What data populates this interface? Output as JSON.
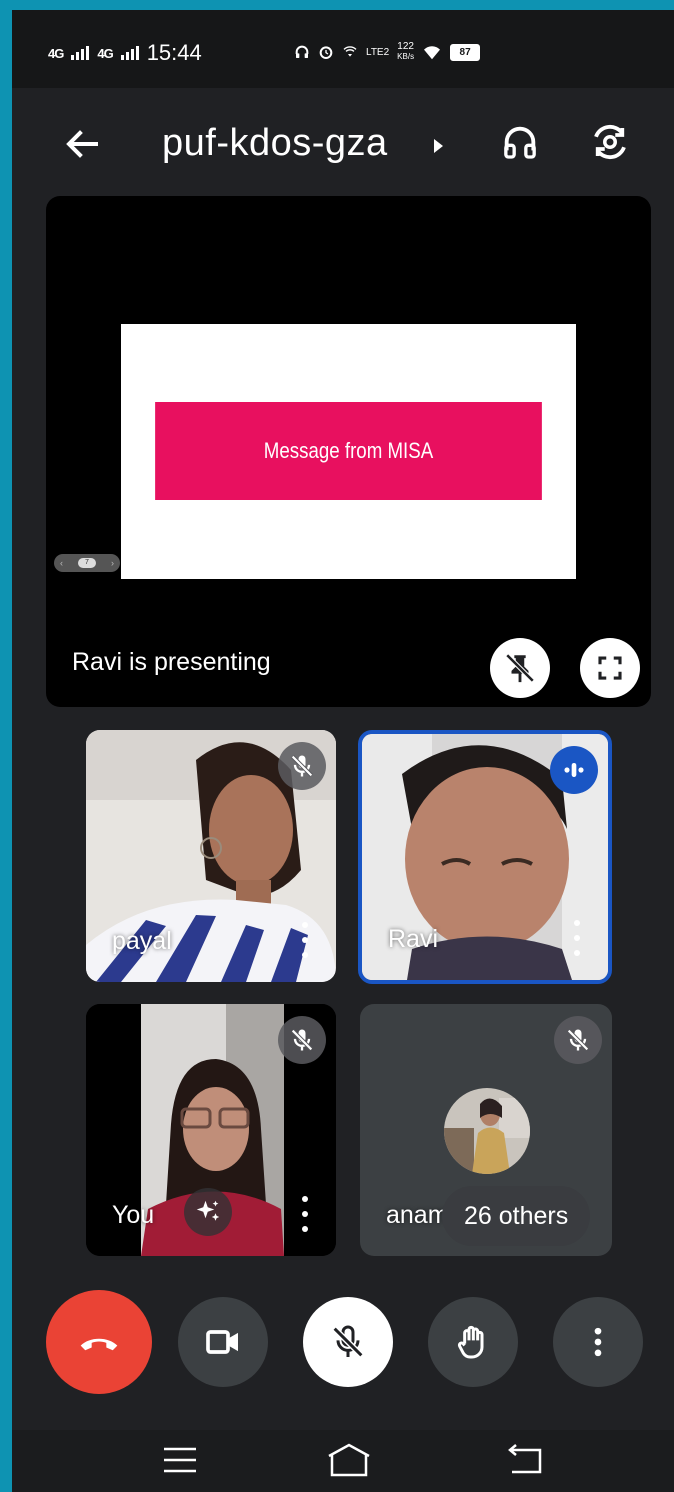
{
  "status_bar": {
    "signal1": "4G",
    "signal2": "4G",
    "time": "15:44",
    "network_type": "LTE2",
    "data_rate": "122",
    "data_rate_unit": "KB/s",
    "battery": "87"
  },
  "header": {
    "meeting_code": "puf-kdos-gza"
  },
  "presentation": {
    "slide_text": "Message from MISA",
    "slide_page": "7",
    "presenter_label": "Ravi is presenting"
  },
  "participants": [
    {
      "name": "payal",
      "muted": true
    },
    {
      "name": "Ravi",
      "speaking": true
    },
    {
      "name": "You",
      "muted": true
    },
    {
      "name": "anami",
      "muted": true,
      "overflow_label": "26 others"
    }
  ],
  "colors": {
    "end_call": "#ea4335",
    "speaking_border": "#1a56c4",
    "slide_band": "#e8105f",
    "frame": "#0e93b2"
  }
}
